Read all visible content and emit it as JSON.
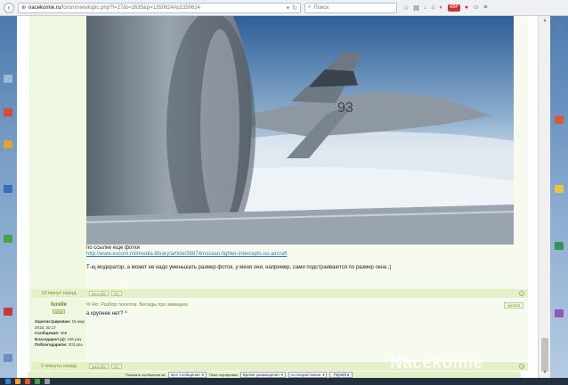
{
  "browser": {
    "url_domain": "nacekomie.ru",
    "url_path": "/forum/viewtopic.php?f=27&t=2635&p=1350624#p1350624",
    "search_placeholder": "Поиск",
    "adblock_badge": "ABP"
  },
  "post1": {
    "photo_number": "93",
    "caption": "по ссылке еще фотки",
    "link": "http://www.eucom.mil/media-library/article/35874/russian-fighter-intercepts-us-aircraft",
    "note": "Т-щ модератор, а может не надо уменьшать размер фоток, у меня они, например, сами подстраиваются по размер окна ;)",
    "time_ago": "10 минут назад",
    "report_label": "жалоба",
    "pm_label": "ЛС"
  },
  "post2": {
    "username": "forelle",
    "online_label": "online",
    "title": "Re: Разбор полетов. Беседы про авиацию.",
    "quote_label": "цитата",
    "text": "а крупнее нет? ^",
    "stats": [
      {
        "label": "Зарегистрирован:",
        "value": "16 мар 2015, 20:17"
      },
      {
        "label": "Сообщения:",
        "value": "466"
      },
      {
        "label": "Благодарил (а):",
        "value": "156 раз."
      },
      {
        "label": "Поблагодарили:",
        "value": "203 раз."
      }
    ],
    "time_ago": "2 минуты назад",
    "report_label": "жалоба",
    "pm_label": "ЛС"
  },
  "sort_bar": {
    "show_label": "Показать сообщения за:",
    "period_value": "Все сообщения",
    "sort_label": "Поле сортировки",
    "sort_value": "Время размещения",
    "order_value": "по возрастанию",
    "go_label": "Перейти"
  },
  "watermark": "Nacekomie"
}
